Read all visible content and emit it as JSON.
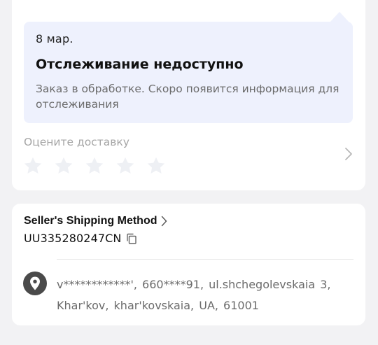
{
  "tracking": {
    "date": "8 мар.",
    "title": "Отслеживание недоступно",
    "description": "Заказ в обработке. Скоро появится информация для отслеживания",
    "rate_label": "Оцените доставку",
    "stars_total": 5,
    "stars_filled": 0
  },
  "shipping": {
    "method_label": "Seller's Shipping Method",
    "tracking_number": "UU335280247CN",
    "address": "v************', 660****91, ul.shchegolevskaia 3, Khar'kov, khar'kovskaia, UA, 61001"
  },
  "colors": {
    "bubble_bg": "#eef1fd",
    "star_empty": "#eef0f4",
    "muted_text": "#6b6b6b",
    "pin_bg": "#4a4a4a"
  },
  "icons": {
    "star": "star-icon",
    "chevron": "chevron-right-icon",
    "copy": "copy-icon",
    "location": "location-pin-icon"
  }
}
